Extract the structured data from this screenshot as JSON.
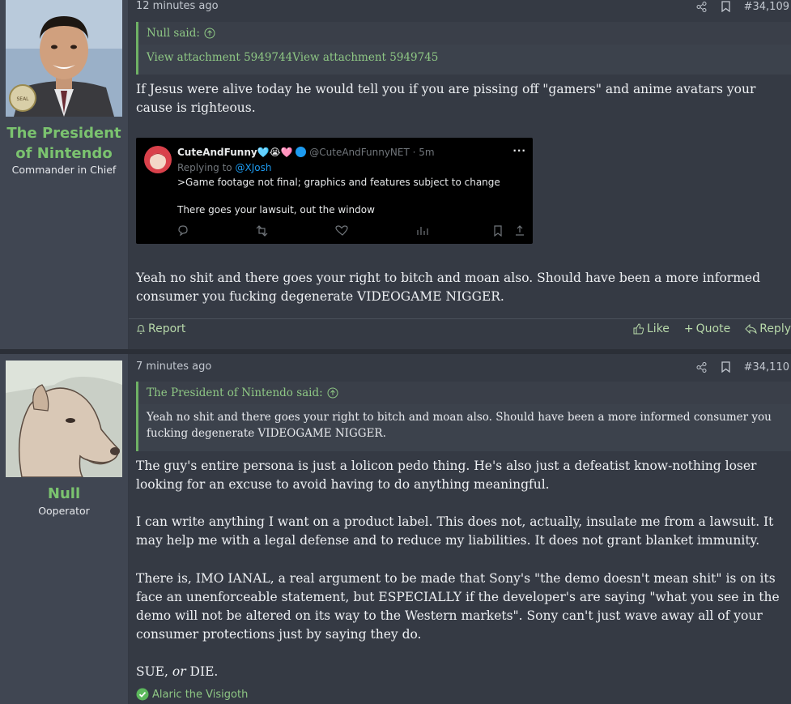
{
  "post1": {
    "user": {
      "name": "The President of Nintendo",
      "title": "Commander in Chief"
    },
    "time": "12 minutes ago",
    "number": "#34,109",
    "quote": {
      "author": "Null said:",
      "attachments": "View attachment 5949744View attachment 5949745"
    },
    "body1": "If Jesus were alive today he would tell you if you are pissing off \"gamers\" and anime avatars your cause is righteous.",
    "tweet": {
      "display_name": "CuteAndFunny",
      "emojis": "🩵😭🩷",
      "handle": "@CuteAndFunnyNET · 5m",
      "replying_prefix": "Replying to ",
      "replying_to": "@XJosh",
      "line1": ">Game footage not final; graphics and features subject to change",
      "line2": "There goes your lawsuit, out the window"
    },
    "body2": "Yeah no shit and there goes your right to bitch and moan also. Should have been a more informed consumer you fucking degenerate VIDEOGAME NIGGER.",
    "actions": {
      "report": "Report",
      "like": "Like",
      "quote": "Quote",
      "reply": "Reply"
    }
  },
  "post2": {
    "user": {
      "name": "Null",
      "title": "Ooperator"
    },
    "time": "7 minutes ago",
    "number": "#34,110",
    "quote": {
      "author": "The President of Nintendo said:",
      "body": "Yeah no shit and there goes your right to bitch and moan also. Should have been a more informed consumer you fucking degenerate VIDEOGAME NIGGER."
    },
    "para1": "The guy's entire persona is just a lolicon pedo thing. He's also just a defeatist know-nothing loser looking for an excuse to avoid having to do anything meaningful.",
    "para2": "I can write anything I want on a product label. This does not, actually, insulate me from a lawsuit. It may help me with a legal defense and to reduce my liabilities. It does not grant blanket immunity.",
    "para3": "There is, IMO IANAL, a real argument to be made that Sony's \"the demo doesn't mean shit\" is on its face an unenforceable statement, but ESPECIALLY if the developer's are saying \"what you see in the demo will not be altered on its way to the Western markets\". Sony can't just wave away all of your consumer protections just by saying they do.",
    "sig_pre": "SUE, ",
    "sig_or": "or",
    "sig_post": " DIE.",
    "reaction": "Alaric the Visigoth"
  },
  "colors": {
    "username": "#7bc36f",
    "accent": "#6fb165"
  }
}
